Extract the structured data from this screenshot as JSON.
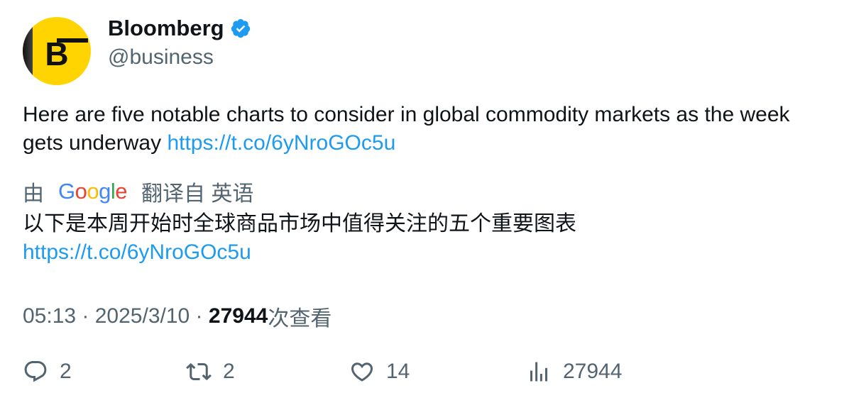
{
  "author": {
    "display_name": "Bloomberg",
    "handle": "@business",
    "avatar_letter": "B"
  },
  "tweet": {
    "text": "Here are five notable charts to consider in global commodity markets as the week gets underway ",
    "link": "https://t.co/6yNroGOc5u"
  },
  "translation": {
    "prefix": "由",
    "provider": "Google",
    "suffix": "翻译自 英语",
    "text": "以下是本周开始时全球商品市场中值得关注的五个重要图表",
    "link": "https://t.co/6yNroGOc5u"
  },
  "meta": {
    "time": "05:13",
    "separator": " · ",
    "date": "2025/3/10",
    "views": "27944",
    "views_label": "次查看"
  },
  "actions": {
    "replies": "2",
    "reposts": "2",
    "likes": "14",
    "views": "27944"
  },
  "colors": {
    "link": "#1d9bf0",
    "secondary_text": "#536471",
    "verified": "#1d9bf0",
    "avatar_bg": "#ffd400"
  }
}
